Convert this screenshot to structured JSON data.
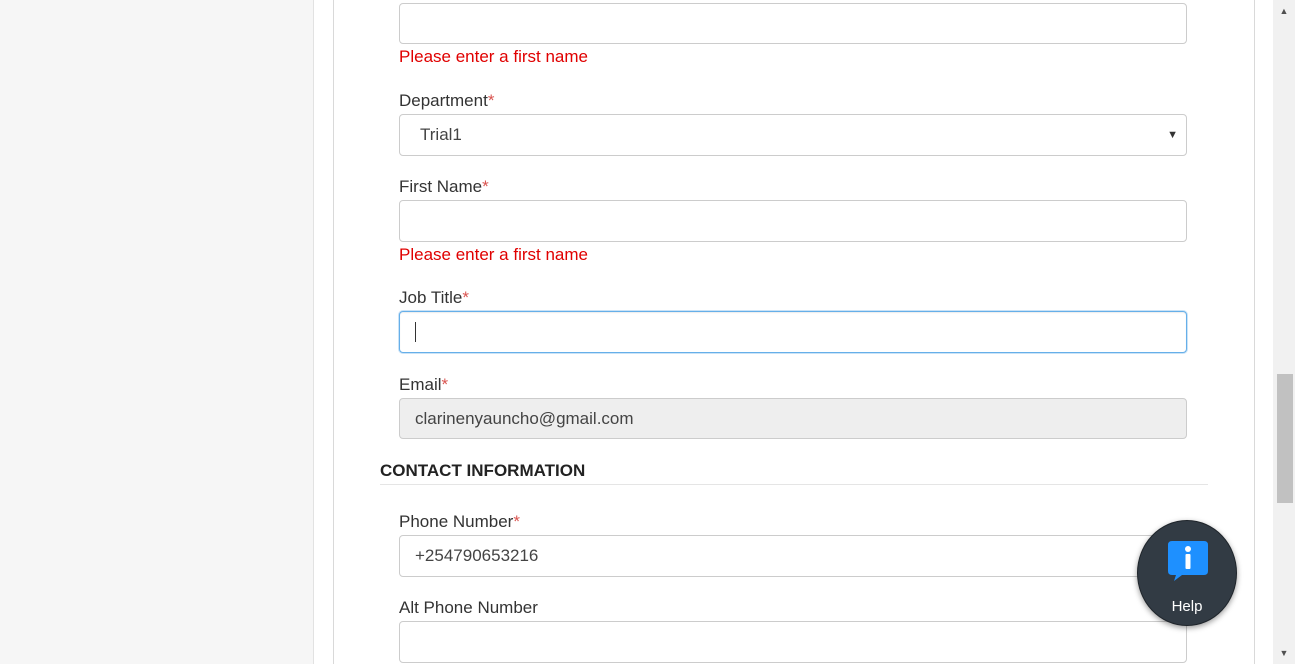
{
  "form": {
    "top_field": {
      "value": ""
    },
    "top_error": "Please enter a first name",
    "department": {
      "label": "Department",
      "required": "*",
      "value": "Trial1"
    },
    "first_name": {
      "label": "First Name",
      "required": "*",
      "value": "",
      "error": "Please enter a first name"
    },
    "job_title": {
      "label": "Job Title",
      "required": "*",
      "value": ""
    },
    "email": {
      "label": "Email",
      "required": "*",
      "value": "clarinenyauncho@gmail.com"
    }
  },
  "contact": {
    "heading": "CONTACT INFORMATION",
    "phone": {
      "label": "Phone Number",
      "required": "*",
      "value": "+254790653216"
    },
    "alt_phone": {
      "label": "Alt Phone Number",
      "value": ""
    }
  },
  "help_widget": {
    "label": "Help",
    "icon": "info-chat-icon",
    "color": "#1e90ff"
  },
  "colors": {
    "error": "#e00000",
    "required": "#d9534f",
    "focus_border": "#66afe9",
    "help_bg": "#323b44"
  }
}
